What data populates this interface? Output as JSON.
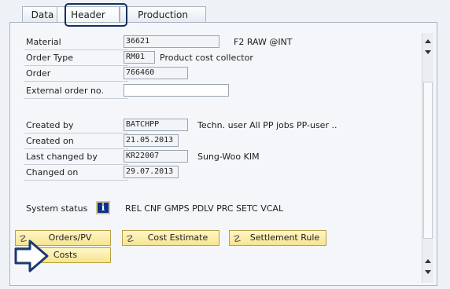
{
  "tabs": [
    {
      "label": "Data"
    },
    {
      "label": "Header"
    },
    {
      "label": "Production Process"
    }
  ],
  "fields": {
    "material": {
      "label": "Material",
      "value": "36621",
      "desc": "F2 RAW @INT"
    },
    "order_type": {
      "label": "Order Type",
      "value": "RM01",
      "desc": "Product cost collector"
    },
    "order": {
      "label": "Order",
      "value": "766460"
    },
    "external_order_no": {
      "label": "External order no.",
      "value": ""
    },
    "created_by": {
      "label": "Created by",
      "value": "BATCHPP",
      "desc": "Techn. user All PP jobs PP-user .."
    },
    "created_on": {
      "label": "Created on",
      "value": "21.05.2013"
    },
    "last_changed_by": {
      "label": "Last changed by",
      "value": "KR22007",
      "desc": "Sung-Woo KIM"
    },
    "changed_on": {
      "label": "Changed on",
      "value": "29.07.2013"
    }
  },
  "system_status": {
    "label": "System status",
    "value": "REL  CNF  GMPS PDLV PRC  SETC VCAL"
  },
  "buttons": {
    "orders_pv": "Orders/PV",
    "cost_estimate": "Cost Estimate",
    "settlement_rule": "Settlement Rule",
    "costs": "Costs"
  },
  "colors": {
    "button_bg": "#f7e58f",
    "highlight_border": "#14305e",
    "info_icon_bg": "#0a2f8a"
  }
}
